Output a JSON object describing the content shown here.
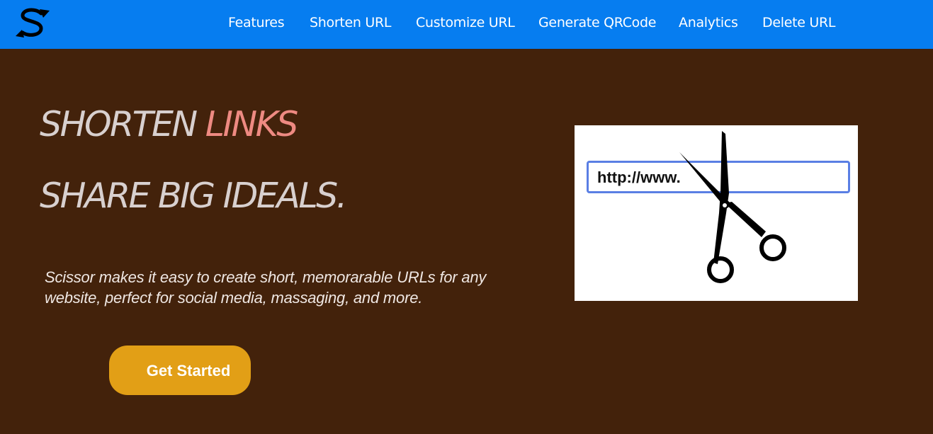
{
  "navbar": {
    "logo_icon": "scissor-s-logo",
    "links": [
      {
        "label": "Features"
      },
      {
        "label": "Shorten URL"
      },
      {
        "label": "Customize URL"
      },
      {
        "label": "Generate QRCode"
      },
      {
        "label": "Analytics"
      },
      {
        "label": "Delete URL"
      }
    ]
  },
  "hero": {
    "line1_prefix": "SHORTEN ",
    "line1_accent": "LINKS",
    "line2": "SHARE BIG IDEALS.",
    "description": "Scissor makes it easy to create short, memorarable URLs for any website, perfect for social media, massaging, and more.",
    "cta_label": "Get Started"
  },
  "illustration": {
    "url_text": "http://www.",
    "icon": "scissors-icon"
  },
  "colors": {
    "navbar": "#067df0",
    "background": "#43220b",
    "accent_text": "#ee8a82",
    "cta": "#e29f16"
  }
}
